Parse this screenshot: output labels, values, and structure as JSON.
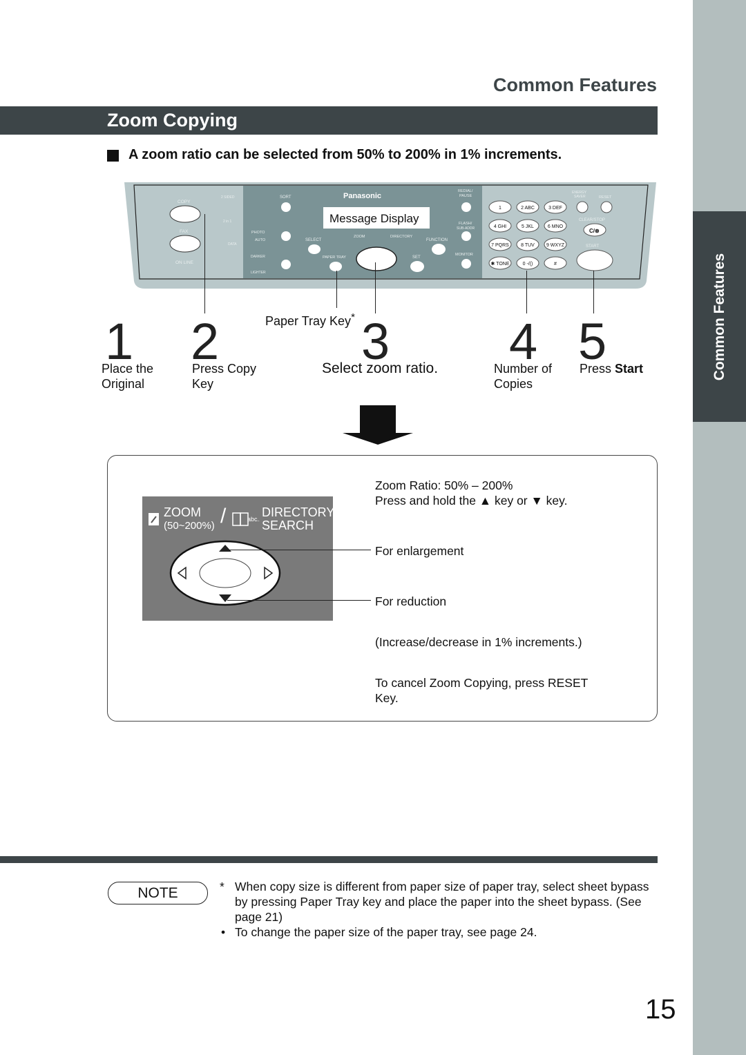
{
  "header": {
    "section": "Common Features",
    "title": "Zoom Copying",
    "lead": "A zoom ratio can be selected from 50% to 200% in 1% increments."
  },
  "side_tab": "Common Features",
  "panel": {
    "brand": "Panasonic",
    "display": "Message Display",
    "copy": "COPY",
    "fax": "FAX",
    "online": "ON LINE",
    "two_sided": "2 SIDED",
    "two_in_one": "2 in 1",
    "data": "DATA",
    "sort": "SORT",
    "photo": "PHOTO",
    "auto": "AUTO",
    "darker": "DARKER",
    "lighter": "LIGHTER",
    "select": "SELECT",
    "percent": "%",
    "paper_tray": "PAPER TRAY",
    "zoom": "ZOOM",
    "zoom_range": "(50~200%)",
    "directory": "DIRECTORY",
    "search": "SEARCH",
    "function": "FUNCTION",
    "set": "SET",
    "redial": "REDIAL/",
    "pause": "PAUSE",
    "flash": "FLASH/",
    "subaddr": "SUB-ADDR",
    "monitor": "MONITOR",
    "energy": "ENERGY",
    "saver": "SAVER",
    "reset": "RESET",
    "clear_stop": "CLEAR/STOP",
    "clear_key": "C/⊗",
    "start": "START",
    "keys": [
      "1",
      "2 ABC",
      "3 DEF",
      "4 GHI",
      "5 JKL",
      "6 MNO",
      "7 PQRS",
      "8 TUV",
      "9 WXYZ",
      "✱ TONE",
      "0 -/()",
      "#"
    ]
  },
  "callout": {
    "paper_tray_key": "Paper Tray Key",
    "asterisk": "*"
  },
  "steps": [
    {
      "num": "1",
      "line1": "Place the",
      "line2": "Original"
    },
    {
      "num": "2",
      "line1": "Press Copy",
      "line2": "Key"
    },
    {
      "num": "3",
      "line1": "Select zoom ratio.",
      "line2": ""
    },
    {
      "num": "4",
      "line1": "Number of",
      "line2": "Copies"
    },
    {
      "num": "5",
      "line1": "Press ",
      "line2": "Start"
    }
  ],
  "detail": {
    "zoom": "ZOOM",
    "range": "(50~200%)",
    "directory": "DIRECTORY",
    "search": "SEARCH",
    "abc": "abc..",
    "ratio": "Zoom Ratio: 50% – 200%",
    "hold": "Press and hold the ▲ key or ▼ key.",
    "enlarge": "For enlargement",
    "reduce": "For reduction",
    "increments": "(Increase/decrease in 1% increments.)",
    "cancel1": "To cancel Zoom Copying, press RESET",
    "cancel2": "Key."
  },
  "note": {
    "label": "NOTE",
    "star": "*",
    "item1_l1": "When copy size is different from paper size of paper tray, select sheet bypass",
    "item1_l2": "by pressing Paper Tray key and place the paper into the sheet bypass. (See",
    "item1_l3": "page 21)",
    "bullet": "•",
    "item2": "To change the paper size of the paper tray, see page 24."
  },
  "page_number": "15"
}
